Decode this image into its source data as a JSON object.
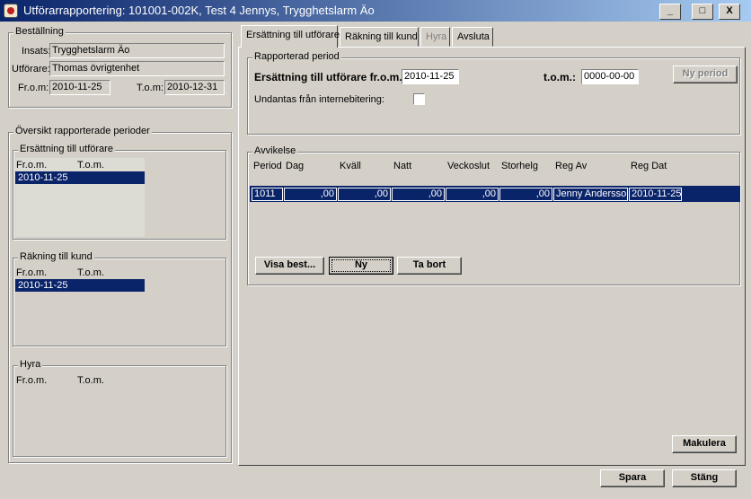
{
  "window": {
    "title": "Utförarrapportering: 101001-002K, Test 4 Jennys, Trygghetslarm Äo",
    "controls": [
      "_",
      "□",
      "X"
    ]
  },
  "bestallning": {
    "legend": "Beställning",
    "insats_label": "Insats:",
    "insats_value": "Trygghetslarm Äo",
    "utforare_label": "Utförare:",
    "utforare_value": "Thomas övrigtenhet",
    "from_label": "Fr.o.m:",
    "from_value": "2010-11-25",
    "tom_label": "T.o.m:",
    "tom_value": "2010-12-31"
  },
  "oversikt": {
    "legend": "Översikt rapporterade perioder",
    "ersattning": {
      "legend": "Ersättning till utförare",
      "col_from": "Fr.o.m.",
      "col_tom": "T.o.m.",
      "rows": [
        "2010-11-25"
      ]
    },
    "rakning": {
      "legend": "Räkning till kund",
      "col_from": "Fr.o.m.",
      "col_tom": "T.o.m.",
      "rows": [
        "2010-11-25"
      ]
    },
    "hyra": {
      "legend": "Hyra",
      "col_from": "Fr.o.m.",
      "col_tom": "T.o.m.",
      "rows": []
    }
  },
  "tabs": [
    {
      "label": "Ersättning till utförare",
      "state": "active"
    },
    {
      "label": "Räkning till kund",
      "state": "normal"
    },
    {
      "label": "Hyra",
      "state": "disabled"
    },
    {
      "label": "Avsluta",
      "state": "normal"
    }
  ],
  "rapporterad": {
    "legend": "Rapporterad period",
    "from_label": "Ersättning till utförare fr.o.m.:",
    "from_value": "2010-11-25",
    "tom_label": "t.o.m.:",
    "tom_value": "0000-00-00",
    "ny_period": "Ny period",
    "undantas_label": "Undantas från internebitering:",
    "undantas_checked": false
  },
  "avvikelse": {
    "legend": "Avvikelse",
    "columns": [
      "Period",
      "Dag",
      "Kväll",
      "Natt",
      "Veckoslut",
      "Storhelg",
      "Reg Av",
      "Reg Dat"
    ],
    "rows": [
      {
        "period": "1011",
        "dag": ",00",
        "kvall": ",00",
        "natt": ",00",
        "veckoslut": ",00",
        "storhelg": ",00",
        "reg_av": "Jenny Andersson",
        "reg_dat": "2010-11-25"
      }
    ],
    "visa_best": "Visa best...",
    "ny": "Ny",
    "ta_bort": "Ta bort"
  },
  "makulera": "Makulera",
  "spara": "Spara",
  "stang": "Stäng"
}
